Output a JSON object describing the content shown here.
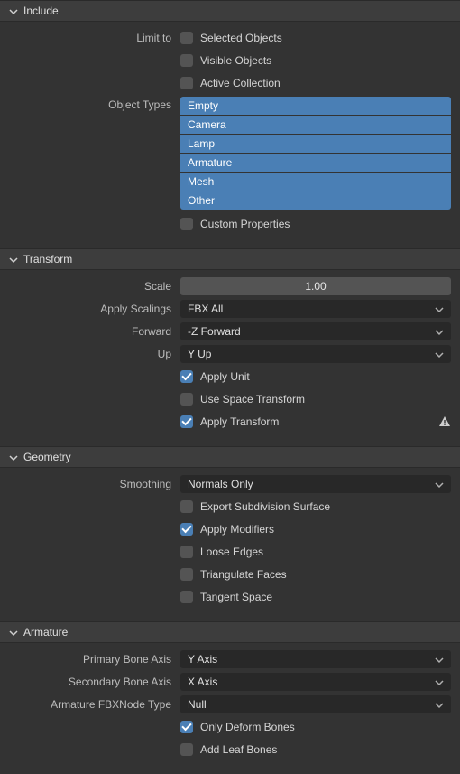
{
  "include": {
    "title": "Include",
    "limit_to_label": "Limit to",
    "selected_objects": "Selected Objects",
    "visible_objects": "Visible Objects",
    "active_collection": "Active Collection",
    "object_types_label": "Object Types",
    "object_types": [
      "Empty",
      "Camera",
      "Lamp",
      "Armature",
      "Mesh",
      "Other"
    ],
    "custom_properties": "Custom Properties"
  },
  "transform": {
    "title": "Transform",
    "scale_label": "Scale",
    "scale_value": "1.00",
    "apply_scalings_label": "Apply Scalings",
    "apply_scalings_value": "FBX All",
    "forward_label": "Forward",
    "forward_value": "-Z Forward",
    "up_label": "Up",
    "up_value": "Y Up",
    "apply_unit": "Apply Unit",
    "use_space_transform": "Use Space Transform",
    "apply_transform": "Apply Transform"
  },
  "geometry": {
    "title": "Geometry",
    "smoothing_label": "Smoothing",
    "smoothing_value": "Normals Only",
    "export_subdiv": "Export Subdivision Surface",
    "apply_modifiers": "Apply Modifiers",
    "loose_edges": "Loose Edges",
    "triangulate_faces": "Triangulate Faces",
    "tangent_space": "Tangent Space"
  },
  "armature": {
    "title": "Armature",
    "primary_bone_axis_label": "Primary Bone Axis",
    "primary_bone_axis_value": "Y Axis",
    "secondary_bone_axis_label": "Secondary Bone Axis",
    "secondary_bone_axis_value": "X Axis",
    "fbxnode_type_label": "Armature FBXNode Type",
    "fbxnode_type_value": "Null",
    "only_deform_bones": "Only Deform Bones",
    "add_leaf_bones": "Add Leaf Bones"
  }
}
